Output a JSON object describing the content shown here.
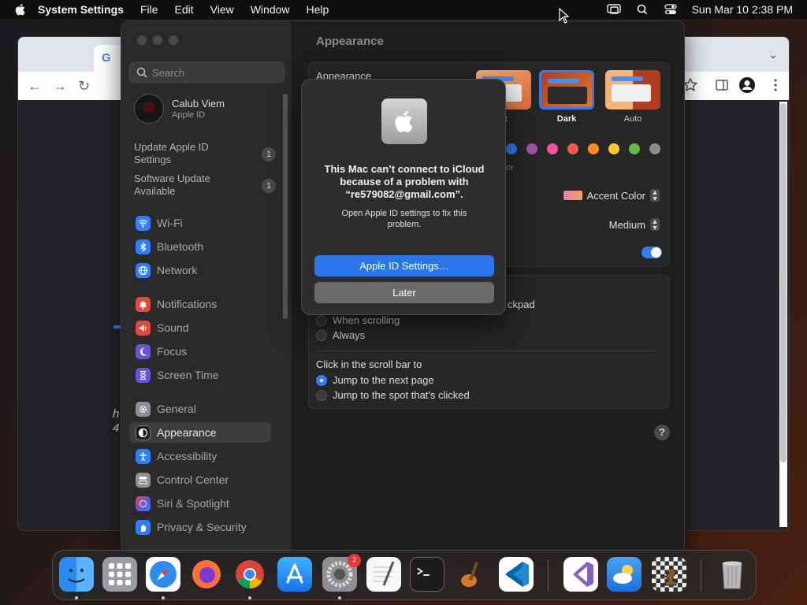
{
  "menubar": {
    "app_name": "System Settings",
    "menus": [
      "File",
      "Edit",
      "View",
      "Window",
      "Help"
    ],
    "clock": "Sun Mar 10  2:38 PM"
  },
  "browser": {
    "tab_glyph": "G",
    "fragment_1": "h",
    "fragment_2": "4"
  },
  "sidebar": {
    "search_placeholder": "Search",
    "account": {
      "name": "Calub Viem",
      "subtitle": "Apple ID"
    },
    "updates": [
      {
        "label": "Update Apple ID Settings",
        "badge": "1"
      },
      {
        "label": "Software Update Available",
        "badge": "1"
      }
    ],
    "items": [
      {
        "label": "Wi-Fi",
        "icon": "wifi-icon",
        "color": "#2f7ef7"
      },
      {
        "label": "Bluetooth",
        "icon": "bluetooth-icon",
        "color": "#2f7ef7"
      },
      {
        "label": "Network",
        "icon": "globe-icon",
        "color": "#2f7ef7"
      },
      {
        "label": "Notifications",
        "icon": "bell-icon",
        "color": "#e5483c"
      },
      {
        "label": "Sound",
        "icon": "speaker-icon",
        "color": "#e5483c"
      },
      {
        "label": "Focus",
        "icon": "moon-icon",
        "color": "#6b53d8"
      },
      {
        "label": "Screen Time",
        "icon": "hourglass-icon",
        "color": "#6b53d8"
      },
      {
        "label": "General",
        "icon": "gear-icon",
        "color": "#8e8e93"
      },
      {
        "label": "Appearance",
        "icon": "appearance-icon",
        "color": "#1c1c1e"
      },
      {
        "label": "Accessibility",
        "icon": "accessibility-icon",
        "color": "#2f7ef7"
      },
      {
        "label": "Control Center",
        "icon": "control-center-icon",
        "color": "#8e8e93"
      },
      {
        "label": "Siri & Spotlight",
        "icon": "siri-icon",
        "color": "#c1448e"
      },
      {
        "label": "Privacy & Security",
        "icon": "hand-icon",
        "color": "#2f7ef7"
      }
    ],
    "selected": "Appearance"
  },
  "content": {
    "title": "Appearance",
    "appearance_label": "Appearance",
    "theme_options": [
      {
        "label": "nt"
      },
      {
        "label": "Dark",
        "selected": true
      },
      {
        "label": "Auto"
      }
    ],
    "accent_swatches": [
      "#2f7ef7",
      "#a550a7",
      "#f74f9e",
      "#fc5753",
      "#fd8c1f",
      "#fec72f",
      "#62ba46",
      "#8c8c8c"
    ],
    "accent_fragment": "or",
    "highlight_color": "Accent Color",
    "sidebar_icon_size": "Medium",
    "tinting_enabled": true,
    "scrollbar_fragment": "ckpad",
    "scrollbar_options": [
      "When scrolling",
      "Always"
    ],
    "click_label": "Click in the scroll bar to",
    "click_options": [
      {
        "label": "Jump to the next page",
        "selected": true
      },
      {
        "label": "Jump to the spot that's clicked",
        "selected": false
      }
    ],
    "help_label": "?"
  },
  "dialog": {
    "message": "This Mac can’t connect to iCloud because of a problem with “re579082@gmail.com”.",
    "detail": "Open Apple ID settings to fix this problem.",
    "primary_button": "Apple ID Settings…",
    "secondary_button": "Later"
  },
  "dock": {
    "apps": [
      "finder-icon",
      "launchpad-icon",
      "safari-icon",
      "firefox-icon",
      "chrome-icon",
      "app-store-icon",
      "system-settings-icon",
      "textedit-icon",
      "terminal-icon",
      "garageband-icon",
      "vscode-icon",
      "visual-studio-icon",
      "weather-icon",
      "chess-icon",
      "trash-icon"
    ],
    "settings_badge": "2"
  }
}
